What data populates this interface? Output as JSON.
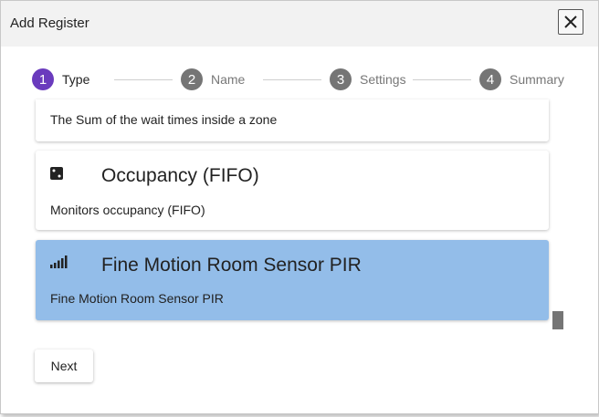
{
  "dialog": {
    "title": "Add Register",
    "close_icon": "close-icon"
  },
  "stepper": {
    "steps": [
      {
        "number": "1",
        "label": "Type",
        "active": true
      },
      {
        "number": "2",
        "label": "Name",
        "active": false
      },
      {
        "number": "3",
        "label": "Settings",
        "active": false
      },
      {
        "number": "4",
        "label": "Summary",
        "active": false
      }
    ]
  },
  "register_types": [
    {
      "title": "",
      "description": "The Sum of the wait times inside a zone",
      "icon": "",
      "selected": false
    },
    {
      "title": "Occupancy (FIFO)",
      "description": "Monitors occupancy (FIFO)",
      "icon": "dice-icon",
      "selected": false
    },
    {
      "title": "Fine Motion Room Sensor PIR",
      "description": "Fine Motion Room Sensor PIR",
      "icon": "signal-bars-icon",
      "selected": true
    }
  ],
  "footer": {
    "next_label": "Next"
  },
  "colors": {
    "active_step": "#6a3bbd",
    "inactive_step": "#757575",
    "active_label": "#222222",
    "inactive_label": "#777777",
    "selected_card": "#93bde9",
    "titlebar": "#f2f2f2"
  }
}
